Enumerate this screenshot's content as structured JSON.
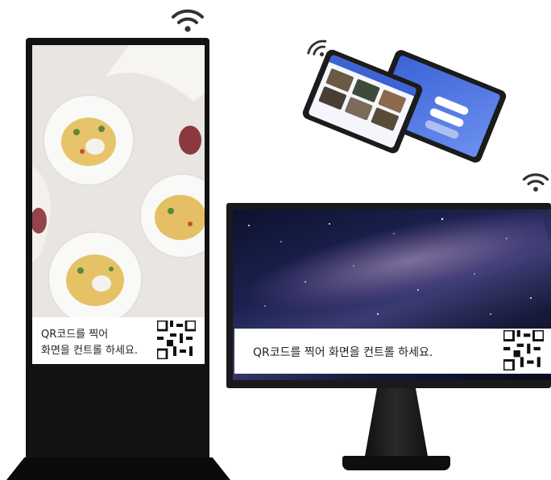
{
  "kiosk": {
    "caption_line1": "QR코드를 찍어",
    "caption_line2": "화면을 컨트롤 하세요."
  },
  "monitor": {
    "caption": "QR코드를 찍어  화면을 컨트롤 하세요."
  },
  "icons": {
    "wifi": "wifi-icon",
    "qr": "qr-code-icon"
  },
  "colors": {
    "tablet_accent": "#3c63d6",
    "frame": "#121212"
  }
}
